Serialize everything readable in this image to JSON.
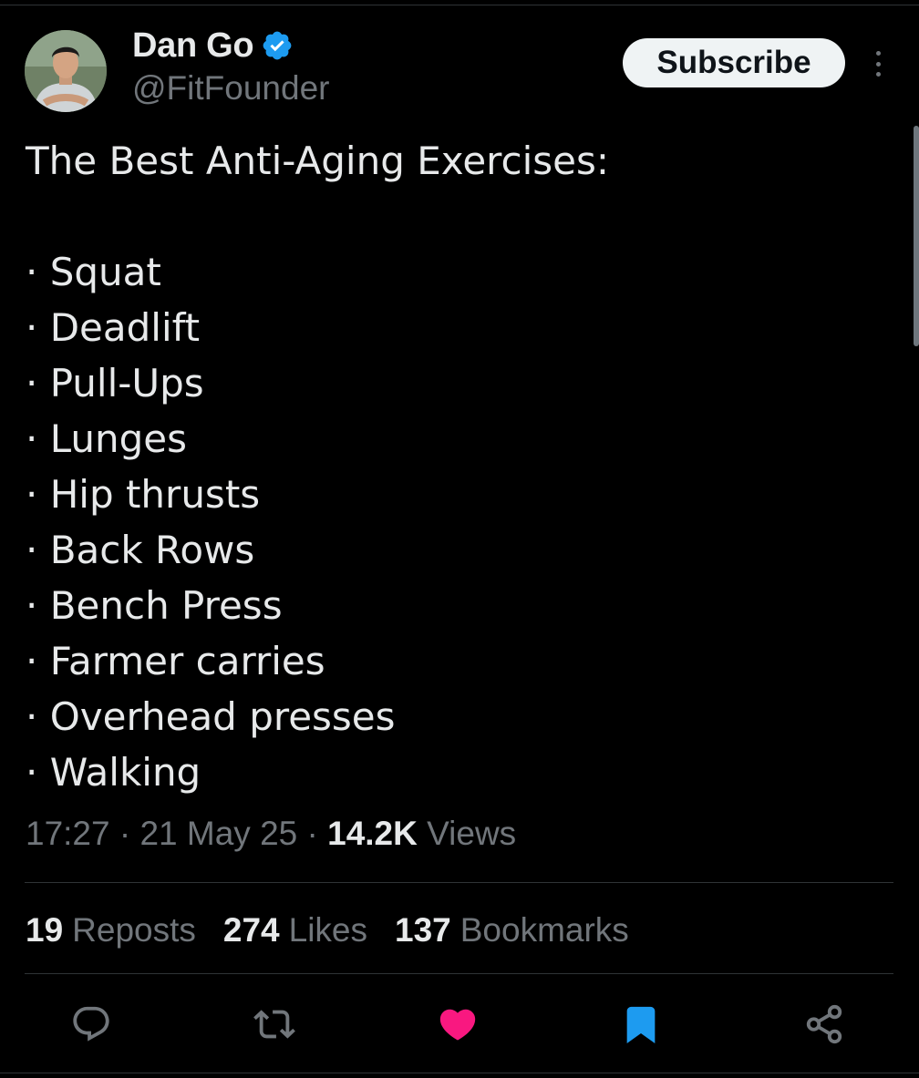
{
  "author": {
    "name": "Dan Go",
    "handle": "@FitFounder",
    "verified": true,
    "verified_color": "#1d9bf0"
  },
  "subscribe_label": "Subscribe",
  "tweet": {
    "title": "The Best Anti-Aging Exercises:",
    "items": [
      "· Squat",
      "· Deadlift",
      "· Pull-Ups",
      "· Lunges",
      "· Hip thrusts",
      "· Back Rows",
      "· Bench Press",
      "· Farmer carries",
      "· Overhead presses",
      "· Walking"
    ]
  },
  "meta": {
    "time": "17:27 · 21 May 25 · ",
    "views_count": "14.2K",
    "views_label": " Views"
  },
  "stats": {
    "reposts_count": "19",
    "reposts_label": "Reposts",
    "likes_count": "274",
    "likes_label": "Likes",
    "bookmarks_count": "137",
    "bookmarks_label": "Bookmarks"
  },
  "actions": [
    {
      "icon": "reply-icon",
      "active": false
    },
    {
      "icon": "repost-icon",
      "active": false
    },
    {
      "icon": "like-icon",
      "active": true,
      "color": "#f91880"
    },
    {
      "icon": "bookmark-icon",
      "active": true,
      "color": "#1d9bf0"
    },
    {
      "icon": "share-icon",
      "active": false
    }
  ],
  "colors": {
    "background": "#000000",
    "text": "#e7e9ea",
    "secondary_text": "#71767b",
    "divider": "#2f3336",
    "like": "#f91880",
    "bookmark": "#1d9bf0"
  }
}
